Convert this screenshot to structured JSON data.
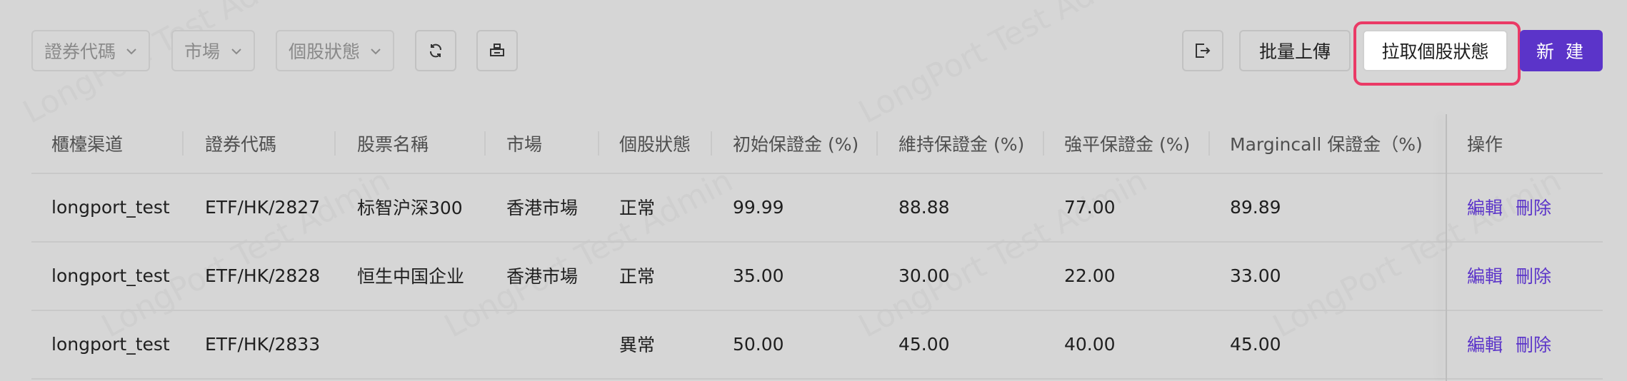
{
  "toolbar": {
    "filters": [
      {
        "label": "證券代碼"
      },
      {
        "label": "市場"
      },
      {
        "label": "個股狀態"
      }
    ],
    "export_icon": "export-icon",
    "batch_upload_label": "批量上傳",
    "pull_status_label": "拉取個股狀態",
    "new_label": "新 建"
  },
  "watermark": {
    "text": "LongPort Test Admin"
  },
  "table": {
    "columns": [
      "櫃檯渠道",
      "證券代碼",
      "股票名稱",
      "市場",
      "個股狀態",
      "初始保證金 (%)",
      "維持保證金 (%)",
      "強平保證金 (%)",
      "Margincall 保證金（%)",
      "操作"
    ],
    "rows": [
      {
        "channel": "longport_test",
        "code": "ETF/HK/2827",
        "name": "标智沪深300",
        "market": "香港市場",
        "status": "正常",
        "initial": "99.99",
        "maintain": "88.88",
        "liquidate": "77.00",
        "margincall": "89.89"
      },
      {
        "channel": "longport_test",
        "code": "ETF/HK/2828",
        "name": "恒生中国企业",
        "market": "香港市場",
        "status": "正常",
        "initial": "35.00",
        "maintain": "30.00",
        "liquidate": "22.00",
        "margincall": "33.00"
      },
      {
        "channel": "longport_test",
        "code": "ETF/HK/2833",
        "name": "",
        "market": "",
        "status": "異常",
        "initial": "50.00",
        "maintain": "45.00",
        "liquidate": "40.00",
        "margincall": "45.00"
      }
    ],
    "action_edit": "編輯",
    "action_delete": "刪除"
  }
}
